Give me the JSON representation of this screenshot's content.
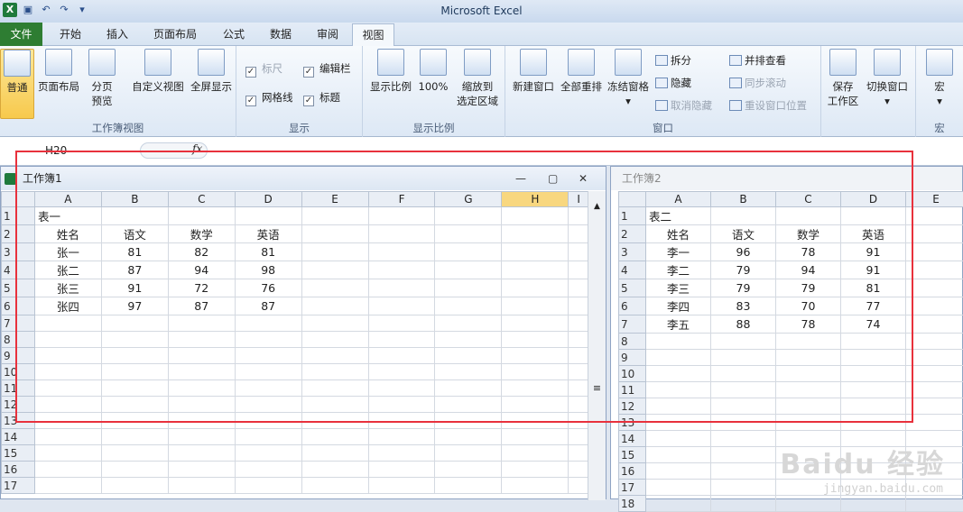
{
  "app": {
    "title": "Microsoft Excel"
  },
  "tabs": [
    "文件",
    "开始",
    "插入",
    "页面布局",
    "公式",
    "数据",
    "审阅",
    "视图"
  ],
  "ribbon": {
    "workbook_views": {
      "label": "工作簿视图",
      "normal": "普通",
      "page_layout": "页面布局",
      "page_break_1": "分页",
      "page_break_2": "预览",
      "custom_views": "自定义视图",
      "full_screen": "全屏显示"
    },
    "show": {
      "label": "显示",
      "ruler": "标尺",
      "gridlines": "网格线",
      "formula_bar": "编辑栏",
      "headings": "标题"
    },
    "zoom": {
      "label": "显示比例",
      "zoom": "显示比例",
      "hundred": "100%",
      "zoom_sel_1": "缩放到",
      "zoom_sel_2": "选定区域"
    },
    "window": {
      "label": "窗口",
      "new_window": "新建窗口",
      "arrange_all": "全部重排",
      "freeze": "冻结窗格",
      "split": "拆分",
      "hide": "隐藏",
      "unhide": "取消隐藏",
      "side_by_side": "并排查看",
      "sync_scroll": "同步滚动",
      "reset_pos": "重设窗口位置",
      "save_ws_1": "保存",
      "save_ws_2": "工作区",
      "switch_win": "切换窗口"
    },
    "macros": {
      "label": "宏",
      "macros": "宏"
    }
  },
  "formula_bar": {
    "name_box": "H20",
    "fx": "fx"
  },
  "book1": {
    "title": "工作簿1",
    "columns": [
      "A",
      "B",
      "C",
      "D",
      "E",
      "F",
      "G",
      "H",
      "I"
    ],
    "rows": [
      [
        "表一",
        "",
        "",
        "",
        ""
      ],
      [
        "姓名",
        "语文",
        "数学",
        "英语",
        ""
      ],
      [
        "张一",
        "81",
        "82",
        "81",
        ""
      ],
      [
        "张二",
        "87",
        "94",
        "98",
        ""
      ],
      [
        "张三",
        "91",
        "72",
        "76",
        ""
      ],
      [
        "张四",
        "97",
        "87",
        "87",
        ""
      ],
      [
        "",
        "",
        "",
        "",
        ""
      ],
      [
        "",
        "",
        "",
        "",
        ""
      ],
      [
        "",
        "",
        "",
        "",
        ""
      ],
      [
        "",
        "",
        "",
        "",
        ""
      ],
      [
        "",
        "",
        "",
        "",
        ""
      ],
      [
        "",
        "",
        "",
        "",
        ""
      ],
      [
        "",
        "",
        "",
        "",
        ""
      ],
      [
        "",
        "",
        "",
        "",
        ""
      ],
      [
        "",
        "",
        "",
        "",
        ""
      ],
      [
        "",
        "",
        "",
        "",
        ""
      ],
      [
        "",
        "",
        "",
        "",
        ""
      ]
    ],
    "row_numbers": [
      "1",
      "2",
      "3",
      "4",
      "5",
      "6",
      "7",
      "8",
      "9",
      "10",
      "11",
      "12",
      "13",
      "14",
      "15",
      "16",
      "17"
    ]
  },
  "book2": {
    "title": "工作簿2",
    "columns": [
      "A",
      "B",
      "C",
      "D",
      "E"
    ],
    "rows": [
      [
        "表二",
        "",
        "",
        ""
      ],
      [
        "姓名",
        "语文",
        "数学",
        "英语"
      ],
      [
        "李一",
        "96",
        "78",
        "91"
      ],
      [
        "李二",
        "79",
        "94",
        "91"
      ],
      [
        "李三",
        "79",
        "79",
        "81"
      ],
      [
        "李四",
        "83",
        "70",
        "77"
      ],
      [
        "李五",
        "88",
        "78",
        "74"
      ]
    ],
    "row_numbers": [
      "1",
      "2",
      "3",
      "4",
      "5",
      "6",
      "7",
      "8",
      "9",
      "10",
      "11",
      "12",
      "13",
      "14",
      "15",
      "16",
      "17",
      "18"
    ]
  },
  "watermark": {
    "main": "Baidu 经验",
    "url": "jingyan.baidu.com"
  },
  "colors": {
    "file_tab": "#2e7d32",
    "highlight_box": "#e8313c",
    "selected_col": "#f8d77f"
  }
}
